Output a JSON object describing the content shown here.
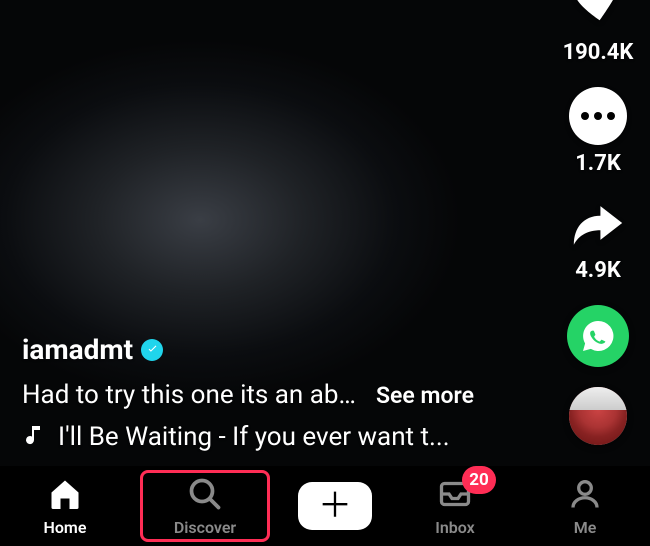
{
  "actions": {
    "like_count": "190.4K",
    "comment_count": "1.7K",
    "share_count": "4.9K"
  },
  "caption": {
    "username": "iamadmt",
    "desc": "Had to try this one its an abs...",
    "see_more": "See more",
    "sound": "I'll Be Waiting - If you ever want t..."
  },
  "nav": {
    "home": "Home",
    "discover": "Discover",
    "inbox": "Inbox",
    "inbox_badge": "20",
    "me": "Me"
  }
}
